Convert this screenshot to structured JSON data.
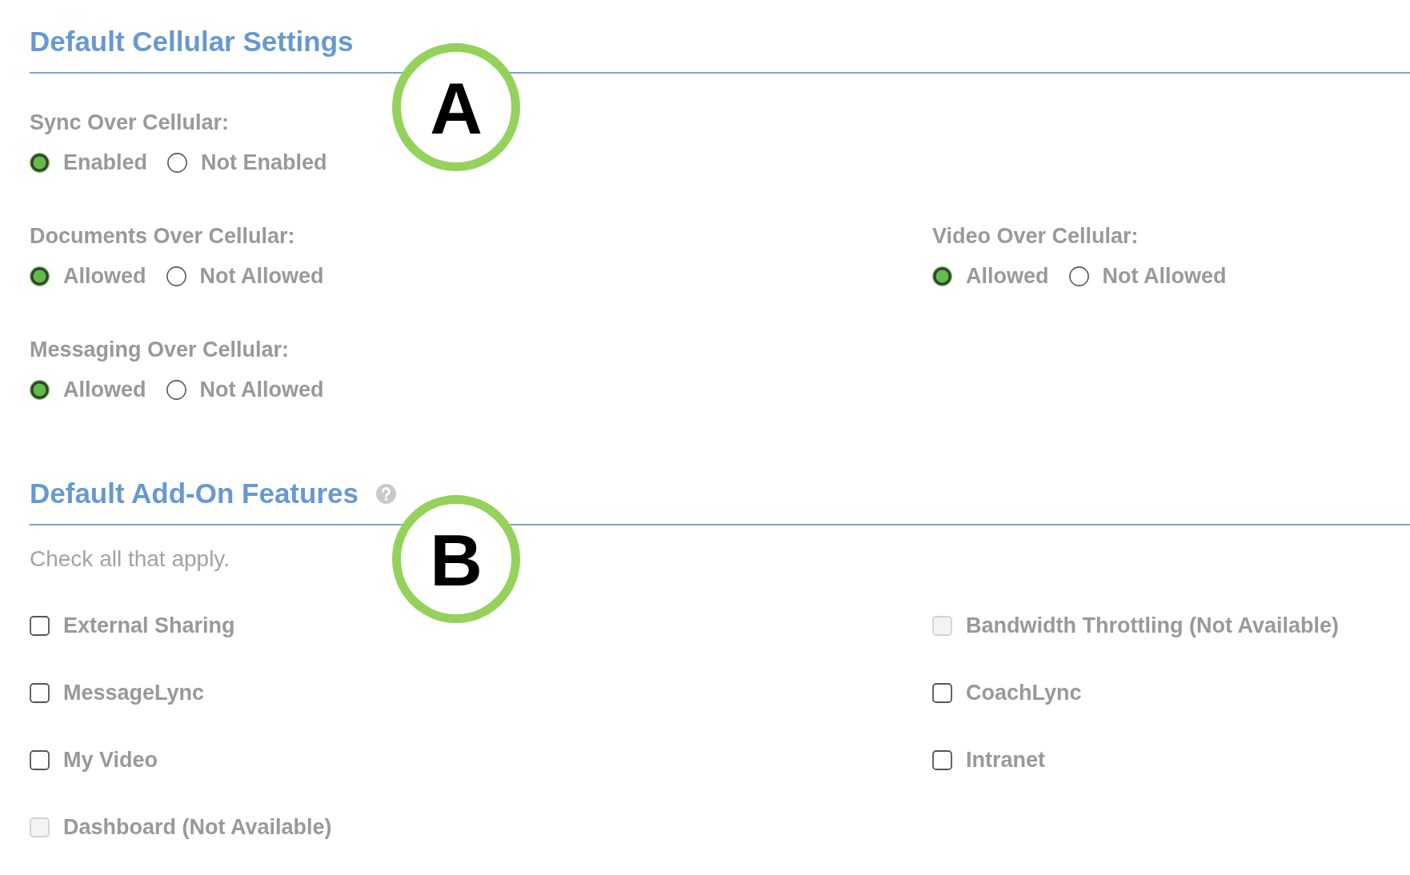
{
  "sections": [
    {
      "kind": "radios",
      "title": "Default Cellular Settings",
      "callout": "A",
      "rows": [
        {
          "settings": [
            {
              "label": "Sync Over Cellular:",
              "options": [
                {
                  "label": "Enabled",
                  "selected": true
                },
                {
                  "label": "Not Enabled",
                  "selected": false
                }
              ]
            }
          ]
        },
        {
          "settings": [
            {
              "label": "Documents Over Cellular:",
              "options": [
                {
                  "label": "Allowed",
                  "selected": true
                },
                {
                  "label": "Not Allowed",
                  "selected": false
                }
              ]
            },
            {
              "label": "Video Over Cellular:",
              "options": [
                {
                  "label": "Allowed",
                  "selected": true
                },
                {
                  "label": "Not Allowed",
                  "selected": false
                }
              ]
            }
          ]
        },
        {
          "settings": [
            {
              "label": "Messaging Over Cellular:",
              "options": [
                {
                  "label": "Allowed",
                  "selected": true
                },
                {
                  "label": "Not Allowed",
                  "selected": false
                }
              ]
            }
          ]
        }
      ]
    },
    {
      "kind": "checkboxes",
      "title": "Default Add-On Features",
      "help": true,
      "callout": "B",
      "hint": "Check all that apply.",
      "rows": [
        {
          "items": [
            {
              "label": "External Sharing",
              "checked": false,
              "disabled": false
            },
            {
              "label": "Bandwidth Throttling (Not Available)",
              "checked": false,
              "disabled": true
            }
          ]
        },
        {
          "items": [
            {
              "label": "MessageLync",
              "checked": false,
              "disabled": false
            },
            {
              "label": "CoachLync",
              "checked": false,
              "disabled": false
            }
          ]
        },
        {
          "items": [
            {
              "label": "My Video",
              "checked": false,
              "disabled": false
            },
            {
              "label": "Intranet",
              "checked": false,
              "disabled": false
            }
          ]
        },
        {
          "items": [
            {
              "label": "Dashboard (Not Available)",
              "checked": false,
              "disabled": true
            }
          ]
        }
      ]
    }
  ]
}
